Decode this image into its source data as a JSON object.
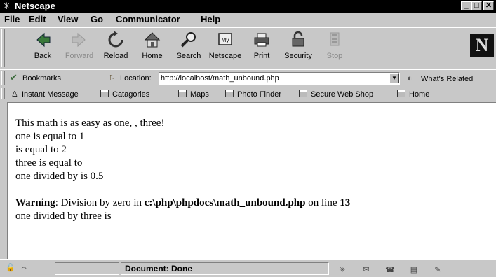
{
  "window": {
    "title": "Netscape",
    "min": "_",
    "max": "□",
    "close": "✕"
  },
  "menu": [
    "File",
    "Edit",
    "View",
    "Go",
    "Communicator",
    "Help"
  ],
  "nav": [
    {
      "label": "Back",
      "icon": "back-arrow-icon"
    },
    {
      "label": "Forward",
      "icon": "forward-arrow-icon"
    },
    {
      "label": "Reload",
      "icon": "reload-icon"
    },
    {
      "label": "Home",
      "icon": "home-icon"
    },
    {
      "label": "Search",
      "icon": "search-icon"
    },
    {
      "label": "Netscape",
      "icon": "netscape-icon"
    },
    {
      "label": "Print",
      "icon": "printer-icon"
    },
    {
      "label": "Security",
      "icon": "lock-icon"
    },
    {
      "label": "Stop",
      "icon": "stop-icon"
    }
  ],
  "location": {
    "bookmarks_label": "Bookmarks",
    "label": "Location:",
    "url": "http://localhost/math_unbound.php",
    "related": "What's Related"
  },
  "personal": [
    "Instant Message",
    "Catagories",
    "Maps",
    "Photo Finder",
    "Secure Web Shop",
    "Home"
  ],
  "content": {
    "line1": "This math is as easy as one, , three!",
    "line2": "one is equal to 1",
    "line3": "is equal to 2",
    "line4": "three is equal to",
    "line5": "one divided by is 0.5",
    "warning_label": "Warning",
    "warning_text1": ": Division by zero in ",
    "warning_path": "c:\\php\\phpdocs\\math_unbound.php",
    "warning_text2": " on line ",
    "warning_line": "13",
    "line6": "one divided by three is"
  },
  "status": {
    "text": "Document: Done"
  }
}
